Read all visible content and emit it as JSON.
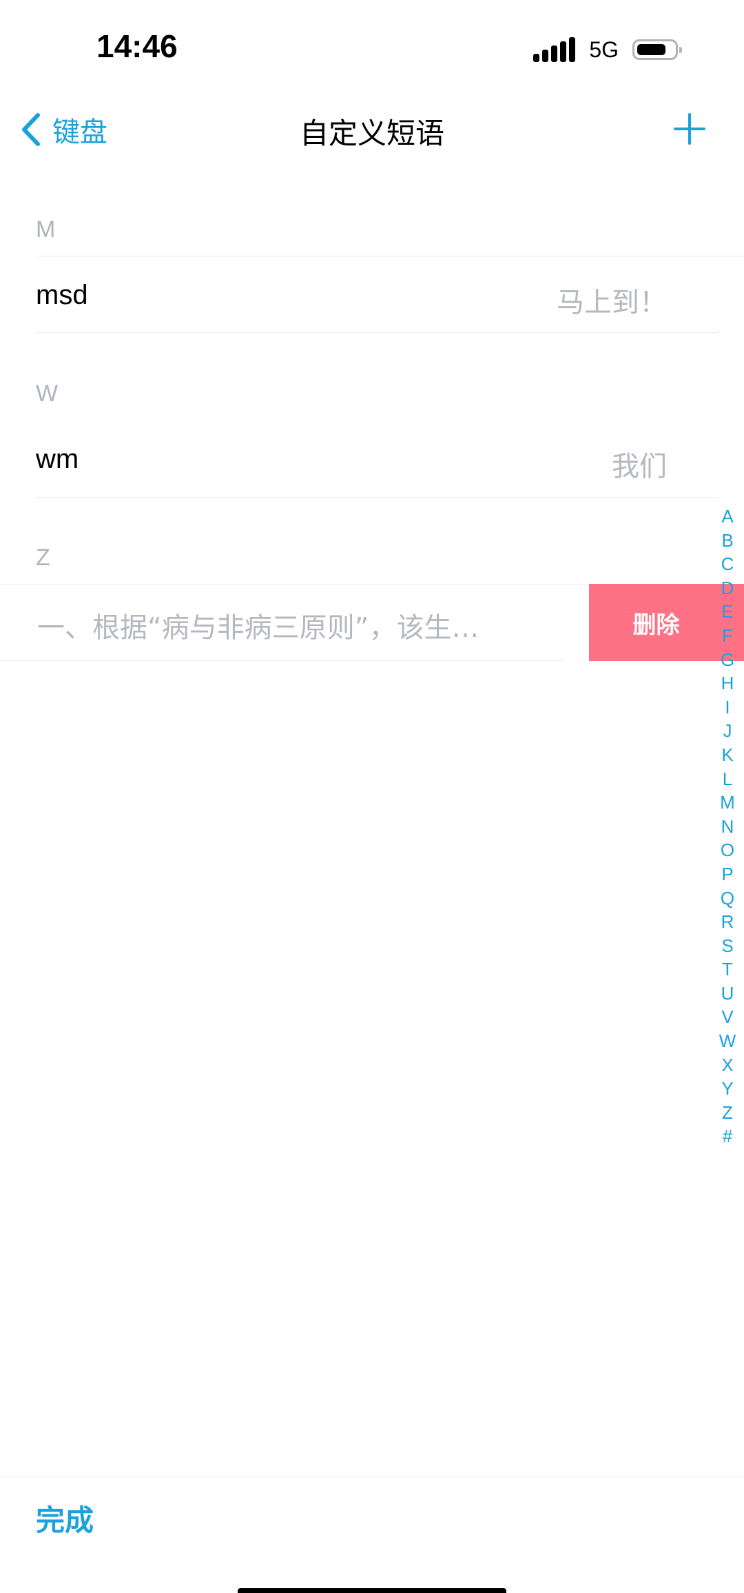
{
  "status_bar": {
    "time": "14:46",
    "network": "5G",
    "battery_level": 0.75
  },
  "nav": {
    "back_label": "键盘",
    "title": "自定义短语",
    "add_icon": "plus-icon",
    "back_icon": "chevron-left-icon"
  },
  "sections": [
    {
      "header": "M",
      "rows": [
        {
          "shortcut": "msd",
          "phrase": "马上到！"
        }
      ]
    },
    {
      "header": "W",
      "rows": [
        {
          "shortcut": "wm",
          "phrase": "我们"
        }
      ]
    },
    {
      "header": "Z",
      "rows": [
        {
          "phrase": "一、根据“病与非病三原则”，该生…",
          "delete_label": "删除"
        }
      ]
    }
  ],
  "index_letters": [
    "A",
    "B",
    "C",
    "D",
    "E",
    "F",
    "G",
    "H",
    "I",
    "J",
    "K",
    "L",
    "M",
    "N",
    "O",
    "P",
    "Q",
    "R",
    "S",
    "T",
    "U",
    "V",
    "W",
    "X",
    "Y",
    "Z",
    "#"
  ],
  "bottom_bar": {
    "done_label": "完成"
  },
  "colors": {
    "accent": "#1aa2dd",
    "delete": "#ff7185",
    "secondary_text": "#b6b8bf"
  }
}
